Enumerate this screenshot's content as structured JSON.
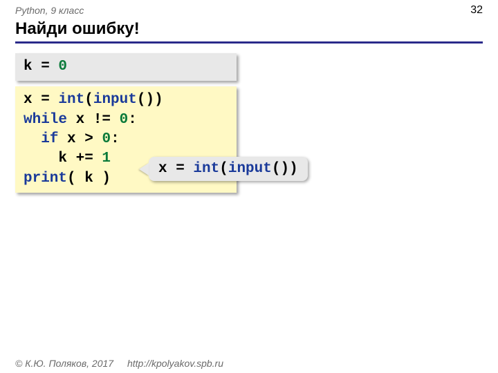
{
  "header": {
    "course": "Python, 9 класс",
    "page": "32"
  },
  "title": "Найди ошибку!",
  "box1": {
    "t1a": "k = ",
    "t1b": "0"
  },
  "box2": {
    "l1a": "x = ",
    "l1b": "int",
    "l1c": "(",
    "l1d": "input",
    "l1e": "())",
    "l2a": "while",
    "l2b": " x != ",
    "l2c": "0",
    "l2d": ":",
    "l3a": "  ",
    "l3b": "if",
    "l3c": " x > ",
    "l3d": "0",
    "l3e": ":",
    "l4a": "    k += ",
    "l4b": "1",
    "l5a": "print",
    "l5b": "( k )"
  },
  "callout": {
    "c1a": "x = ",
    "c1b": "int",
    "c1c": "(",
    "c1d": "input",
    "c1e": "())"
  },
  "footer": {
    "author": "© К.Ю. Поляков, 2017",
    "url": "http://kpolyakov.spb.ru"
  }
}
